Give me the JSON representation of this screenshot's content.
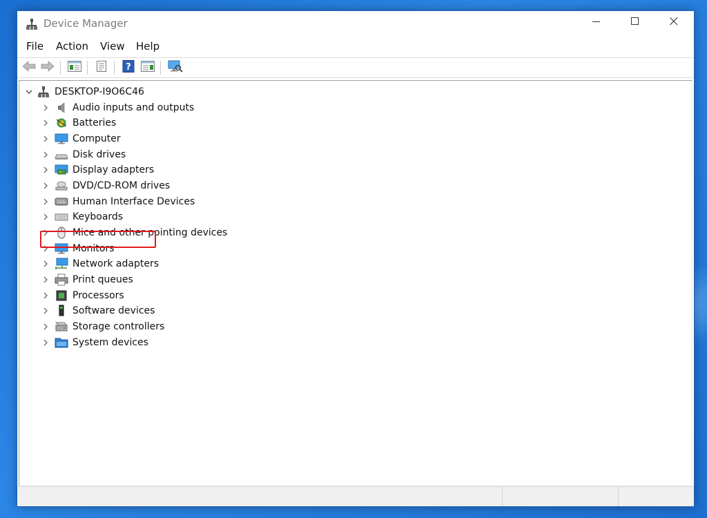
{
  "window": {
    "title": "Device Manager",
    "icons": {
      "app": "device-manager-icon",
      "minimize": "minimize-icon",
      "maximize": "maximize-icon",
      "close": "close-icon"
    }
  },
  "menu": {
    "items": [
      {
        "label": "File"
      },
      {
        "label": "Action"
      },
      {
        "label": "View"
      },
      {
        "label": "Help"
      }
    ]
  },
  "toolbar": {
    "buttons": [
      {
        "icon": "back-arrow-icon",
        "enabled": false
      },
      {
        "icon": "forward-arrow-icon",
        "enabled": false
      },
      {
        "icon": "show-hide-console-tree-icon",
        "enabled": true
      },
      {
        "icon": "properties-icon",
        "enabled": true
      },
      {
        "icon": "help-icon",
        "enabled": true
      },
      {
        "icon": "show-action-pane-icon",
        "enabled": true
      },
      {
        "icon": "scan-hardware-changes-icon",
        "enabled": true
      }
    ]
  },
  "tree": {
    "root": {
      "label": "DESKTOP-I9O6C46",
      "expanded": true,
      "icon": "computer-root-icon"
    },
    "categories": [
      {
        "label": "Audio inputs and outputs",
        "icon": "speaker-icon"
      },
      {
        "label": "Batteries",
        "icon": "battery-icon"
      },
      {
        "label": "Computer",
        "icon": "monitor-icon"
      },
      {
        "label": "Disk drives",
        "icon": "disk-drive-icon"
      },
      {
        "label": "Display adapters",
        "icon": "display-adapter-icon",
        "highlighted": true
      },
      {
        "label": "DVD/CD-ROM drives",
        "icon": "dvd-drive-icon"
      },
      {
        "label": "Human Interface Devices",
        "icon": "hid-icon"
      },
      {
        "label": "Keyboards",
        "icon": "keyboard-icon"
      },
      {
        "label": "Mice and other pointing devices",
        "icon": "mouse-icon"
      },
      {
        "label": "Monitors",
        "icon": "monitor-icon"
      },
      {
        "label": "Network adapters",
        "icon": "network-adapter-icon"
      },
      {
        "label": "Print queues",
        "icon": "printer-icon"
      },
      {
        "label": "Processors",
        "icon": "processor-icon"
      },
      {
        "label": "Software devices",
        "icon": "software-device-icon"
      },
      {
        "label": "Storage controllers",
        "icon": "storage-controller-icon"
      },
      {
        "label": "System devices",
        "icon": "system-devices-icon"
      }
    ]
  },
  "colors": {
    "desktop": "#2b86e6",
    "window_border": "#1a5fb4",
    "highlight_box": "#e0191e",
    "monitor_blue": "#3a9ae6"
  }
}
